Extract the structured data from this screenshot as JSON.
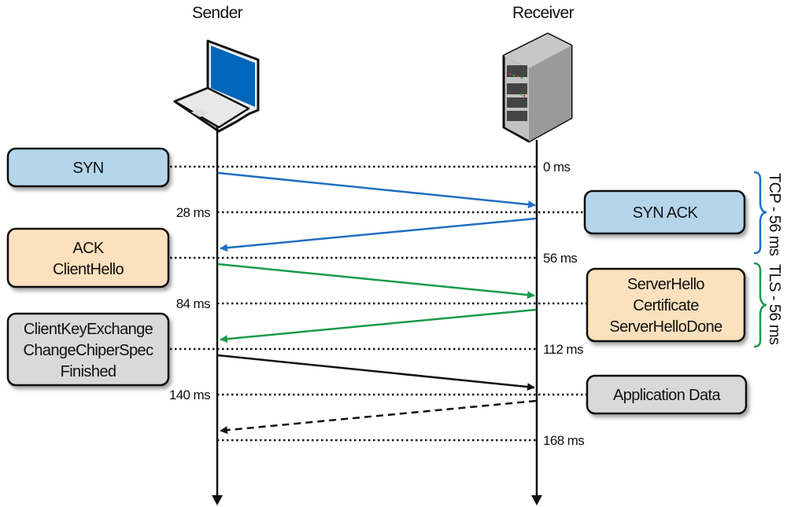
{
  "colors": {
    "tcp_box": "#b4d5ea",
    "tls_box": "#fde0bd",
    "app_box": "#d9d9d9",
    "tcp_arrow": "#1f6fbf",
    "tls_arrow": "#1a9a4a",
    "data_arrow": "#111111"
  },
  "actors": {
    "sender": {
      "label": "Sender",
      "icon": "laptop-icon"
    },
    "receiver": {
      "label": "Receiver",
      "icon": "server-icon"
    }
  },
  "times": [
    "0 ms",
    "28 ms",
    "56 ms",
    "84 ms",
    "112 ms",
    "140 ms",
    "168 ms"
  ],
  "sender_messages": [
    {
      "lines": [
        "SYN"
      ]
    },
    {
      "lines": [
        "ACK",
        "ClientHello"
      ]
    },
    {
      "lines": [
        "ClientKeyExchange",
        "ChangeChiperSpec",
        "Finished"
      ]
    }
  ],
  "receiver_messages": [
    {
      "lines": [
        "SYN ACK"
      ]
    },
    {
      "lines": [
        "ServerHello",
        "Certificate",
        "ServerHelloDone"
      ]
    },
    {
      "lines": [
        "Application Data"
      ]
    }
  ],
  "phases": [
    {
      "label": "TCP - 56 ms"
    },
    {
      "label": "TLS - 56 ms"
    }
  ]
}
